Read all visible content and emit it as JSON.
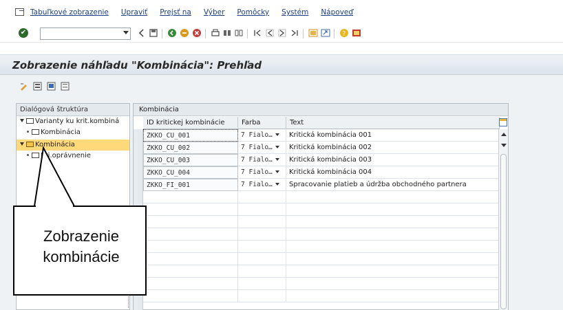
{
  "menu": {
    "items": [
      "Tabuľkové zobrazenie",
      "Upraviť",
      "Prejsť na",
      "Výber",
      "Pomôcky",
      "Systém",
      "Nápoveď"
    ]
  },
  "toolbar": {
    "command_value": "",
    "icons": [
      "back-icon",
      "save-icon",
      "back-green-icon",
      "exit-icon",
      "cancel-icon",
      "print-icon",
      "find-icon",
      "find-next-icon",
      "first-page-icon",
      "previous-page-icon",
      "next-page-icon",
      "last-page-icon",
      "create-session-icon",
      "shortcut-icon",
      "help-icon",
      "layout-icon"
    ]
  },
  "title": "Zobrazenie náhľadu \"Kombinácia\": Prehľad",
  "tree": {
    "header": "Dialógová štruktúra",
    "nodes": [
      {
        "label": "Varianty ku krit.kombiná",
        "level": 0,
        "expanded": true
      },
      {
        "label": "Kombinácia",
        "level": 1
      },
      {
        "label": "Kombinácia",
        "level": 0,
        "expanded": true,
        "selected": true
      },
      {
        "label": "Kri.oprávnenie",
        "level": 1
      }
    ]
  },
  "table": {
    "title": "Kombinácia",
    "columns": [
      "ID kritickej kombinácie",
      "Farba",
      "Text"
    ],
    "rows": [
      {
        "id": "ZKKO_CU_001",
        "farba": "7 Fialo…",
        "text": "Kritická kombinácia 001"
      },
      {
        "id": "ZKKO_CU_002",
        "farba": "7 Fialo…",
        "text": "Kritická kombinácia 002"
      },
      {
        "id": "ZKKO_CU_003",
        "farba": "7 Fialo…",
        "text": "Kritická kombinácia 003"
      },
      {
        "id": "ZKKO_CU_004",
        "farba": "7 Fialo…",
        "text": "Kritická kombinácia 004"
      },
      {
        "id": "ZKKO_FI_001",
        "farba": "7 Fialo…",
        "text": "Spracovanie platieb a údržba obchodného partnera"
      }
    ],
    "empty_rows": 9
  },
  "callout": {
    "line1": "Zobrazenie",
    "line2": "kombinácie"
  },
  "colors": {
    "selected_row": "#ffd97a",
    "menu_text": "#1d3f82",
    "check_green": "#2c6b2c"
  }
}
